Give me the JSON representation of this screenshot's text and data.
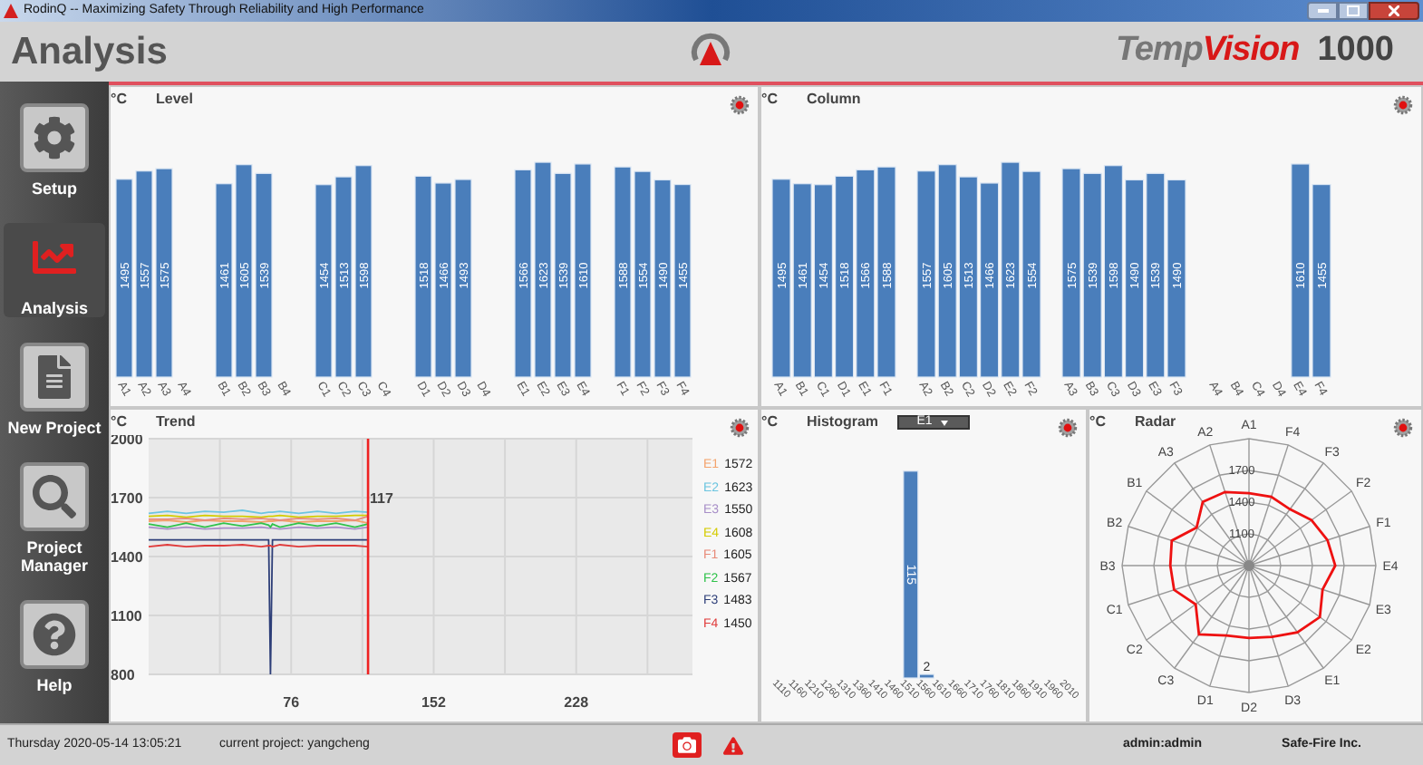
{
  "window": {
    "title": "RodinQ -- Maximizing Safety Through Reliability and High Performance"
  },
  "header": {
    "title": "Analysis",
    "brand": {
      "prefix": "Temp",
      "suffix": "Vision"
    },
    "model": "1000"
  },
  "sidebar": {
    "items": [
      {
        "label": "Setup",
        "selected": false
      },
      {
        "label": "Analysis",
        "selected": true
      },
      {
        "label": "New Project",
        "selected": false
      },
      {
        "label": "Project Manager",
        "selected": false
      },
      {
        "label": "Help",
        "selected": false
      }
    ]
  },
  "level": {
    "unit": "°C",
    "title": "Level",
    "chart_data": {
      "type": "bar",
      "categories": [
        "A1",
        "A2",
        "A3",
        "A4",
        "B1",
        "B2",
        "B3",
        "B4",
        "C1",
        "C2",
        "C3",
        "C4",
        "D1",
        "D2",
        "D3",
        "D4",
        "E1",
        "E2",
        "E3",
        "E4",
        "F1",
        "F2",
        "F3",
        "F4"
      ],
      "values": [
        1495,
        1557,
        1575,
        null,
        1461,
        1605,
        1539,
        null,
        1454,
        1513,
        1598,
        null,
        1518,
        1466,
        1493,
        null,
        1566,
        1623,
        1539,
        1610,
        1588,
        1554,
        1490,
        1455
      ],
      "data_labels": true
    }
  },
  "column": {
    "unit": "°C",
    "title": "Column",
    "chart_data": {
      "type": "bar",
      "categories": [
        "A1",
        "B1",
        "C1",
        "D1",
        "E1",
        "F1",
        "A2",
        "B2",
        "C2",
        "D2",
        "E2",
        "F2",
        "A3",
        "B3",
        "C3",
        "D3",
        "E3",
        "F3",
        "A4",
        "B4",
        "C4",
        "D4",
        "E4",
        "F4"
      ],
      "values": [
        1495,
        1461,
        1454,
        1518,
        1566,
        1588,
        1557,
        1605,
        1513,
        1466,
        1623,
        1554,
        1575,
        1539,
        1598,
        1490,
        1539,
        1490,
        null,
        null,
        null,
        null,
        1610,
        1455
      ],
      "data_labels": true
    }
  },
  "trend": {
    "unit": "°C",
    "title": "Trend",
    "chart_data": {
      "type": "line",
      "x": [
        0,
        10,
        20,
        30,
        40,
        50,
        60,
        64,
        65,
        66,
        70,
        80,
        90,
        100,
        110,
        117
      ],
      "series": [
        {
          "name": "E1",
          "color": "#f4a36c",
          "values": [
            1580,
            1585,
            1575,
            1585,
            1580,
            1580,
            1575,
            1580,
            1580,
            1580,
            1585,
            1575,
            1580,
            1580,
            1585,
            1570
          ]
        },
        {
          "name": "E2",
          "color": "#6cc5e0",
          "values": [
            1620,
            1630,
            1620,
            1630,
            1625,
            1635,
            1620,
            1625,
            1625,
            1625,
            1630,
            1620,
            1630,
            1620,
            1630,
            1625
          ]
        },
        {
          "name": "E3",
          "color": "#a88fc8",
          "values": [
            1550,
            1540,
            1550,
            1540,
            1545,
            1545,
            1550,
            1545,
            1545,
            1545,
            1540,
            1550,
            1545,
            1550,
            1540,
            1550
          ]
        },
        {
          "name": "E4",
          "color": "#d4cc00",
          "values": [
            1605,
            1610,
            1600,
            1610,
            1605,
            1605,
            1600,
            1605,
            1605,
            1605,
            1610,
            1600,
            1605,
            1605,
            1610,
            1610
          ]
        },
        {
          "name": "F1",
          "color": "#e88a78",
          "values": [
            1590,
            1590,
            1595,
            1585,
            1595,
            1590,
            1595,
            1590,
            1590,
            1590,
            1585,
            1595,
            1590,
            1595,
            1585,
            1605
          ]
        },
        {
          "name": "F2",
          "color": "#2fc24a",
          "values": [
            1565,
            1550,
            1570,
            1550,
            1570,
            1555,
            1570,
            1560,
            1550,
            1565,
            1550,
            1570,
            1555,
            1570,
            1550,
            1565
          ]
        },
        {
          "name": "F3",
          "color": "#2d3e78",
          "values": [
            1485,
            1485,
            1485,
            1485,
            1485,
            1485,
            1485,
            1485,
            800,
            1485,
            1485,
            1485,
            1485,
            1485,
            1485,
            1485
          ]
        },
        {
          "name": "F4",
          "color": "#e03a3a",
          "values": [
            1450,
            1460,
            1450,
            1455,
            1455,
            1460,
            1450,
            1455,
            1455,
            1450,
            1460,
            1450,
            1455,
            1455,
            1455,
            1450
          ]
        }
      ],
      "xlim": [
        0,
        290
      ],
      "ylim": [
        800,
        2000
      ],
      "xticks": [
        76,
        152,
        228
      ],
      "yticks": [
        800,
        1100,
        1400,
        1700,
        2000
      ],
      "grid": true,
      "ref_lines": [
        {
          "axis": "x",
          "value": 117,
          "color": "#ee2222"
        }
      ],
      "annotations": [
        "117"
      ]
    },
    "legend": [
      {
        "reading": "1572"
      },
      {
        "reading": "1623"
      },
      {
        "reading": "1550"
      },
      {
        "reading": "1608"
      },
      {
        "reading": "1605"
      },
      {
        "reading": "1567"
      },
      {
        "reading": "1483"
      },
      {
        "reading": "1450"
      }
    ]
  },
  "histogram": {
    "unit": "°C",
    "title": "Histogram",
    "selector": {
      "value": "E1"
    },
    "chart_data": {
      "type": "bar",
      "categories": [
        "1110",
        "1160",
        "1210",
        "1260",
        "1310",
        "1360",
        "1410",
        "1460",
        "1510",
        "1560",
        "1610",
        "1660",
        "1710",
        "1760",
        "1810",
        "1860",
        "1910",
        "1960",
        "2010"
      ],
      "values": [
        null,
        null,
        null,
        null,
        null,
        null,
        null,
        null,
        115,
        2,
        null,
        null,
        null,
        null,
        null,
        null,
        null,
        null,
        null
      ],
      "data_labels": true
    }
  },
  "radar": {
    "unit": "°C",
    "title": "Radar",
    "axes": [
      "A1",
      "F4",
      "F3",
      "F2",
      "F1",
      "E4",
      "E3",
      "E2",
      "E1",
      "D3",
      "D2",
      "D1",
      "C3",
      "C2",
      "C1",
      "B3",
      "B2",
      "B1",
      "A3",
      "A2"
    ],
    "rings": [
      "1700",
      "1400",
      "1100"
    ]
  },
  "status_bar": {
    "datetime": "Thursday 2020-05-14 13:05:21",
    "project": "current project: yangcheng",
    "user": "admin:admin",
    "company": "Safe-Fire Inc."
  }
}
